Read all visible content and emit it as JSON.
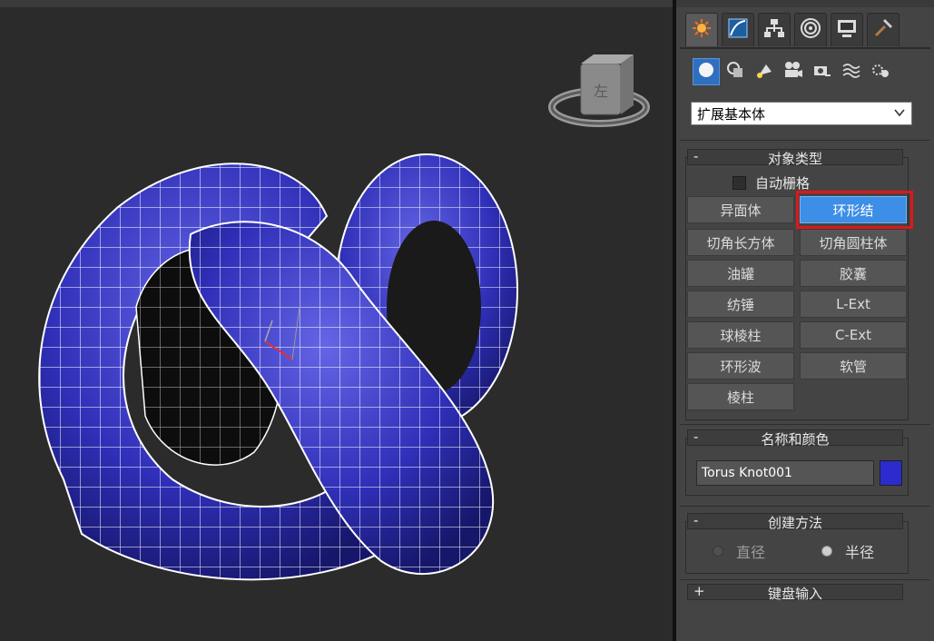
{
  "command_panel": {
    "tabs": [
      {
        "name": "create-tab",
        "icon": "sun-icon",
        "active": true
      },
      {
        "name": "modify-tab",
        "icon": "curve-icon",
        "active": false
      },
      {
        "name": "hierarchy-tab",
        "icon": "hierarchy-icon",
        "active": false
      },
      {
        "name": "motion-tab",
        "icon": "motion-icon",
        "active": false
      },
      {
        "name": "display-tab",
        "icon": "display-icon",
        "active": false
      },
      {
        "name": "utilities-tab",
        "icon": "hammer-icon",
        "active": false
      }
    ],
    "categories": [
      {
        "icon": "sphere-icon",
        "active": true
      },
      {
        "icon": "shapes-icon",
        "active": false
      },
      {
        "icon": "light-icon",
        "active": false
      },
      {
        "icon": "camera-icon",
        "active": false
      },
      {
        "icon": "helper-icon",
        "active": false
      },
      {
        "icon": "spacewarp-icon",
        "active": false
      },
      {
        "icon": "systems-icon",
        "active": false
      }
    ],
    "category_dropdown": "扩展基本体",
    "object_type": {
      "header_sign": "-",
      "title": "对象类型",
      "autogrid_label": "自动栅格",
      "autogrid_checked": false,
      "buttons": [
        "异面体",
        "环形结",
        "切角长方体",
        "切角圆柱体",
        "油罐",
        "胶囊",
        "纺锤",
        "L-Ext",
        "球棱柱",
        "C-Ext",
        "环形波",
        "软管",
        "棱柱"
      ],
      "selected": "环形结"
    },
    "name_and_color": {
      "header_sign": "-",
      "title": "名称和颜色",
      "object_name": "Torus Knot001",
      "color": "#2b2bcf"
    },
    "creation_method": {
      "header_sign": "-",
      "title": "创建方法",
      "options": [
        "直径",
        "半径"
      ],
      "selected": "半径"
    },
    "keyboard_entry": {
      "header_sign": "+",
      "title": "键盘输入"
    }
  },
  "viewport": {
    "background": "#2b2b2b",
    "object_color": "#2f2fb8",
    "viewcube_label": "左"
  }
}
